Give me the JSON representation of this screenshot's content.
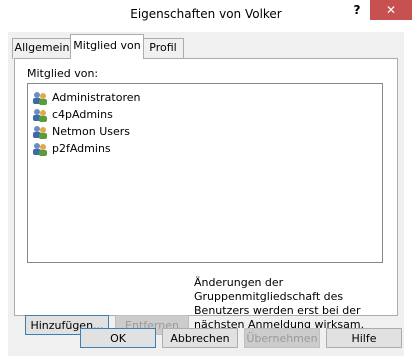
{
  "window": {
    "title": "Eigenschaften von Volker",
    "help": "?",
    "close": "✕"
  },
  "tabs": [
    {
      "label": "Allgemein",
      "active": false
    },
    {
      "label": "Mitglied von",
      "active": true
    },
    {
      "label": "Profil",
      "active": false
    }
  ],
  "member_of": {
    "label": "Mitglied von:",
    "items": [
      {
        "name": "Administratoren",
        "icon": "group-icon"
      },
      {
        "name": "c4pAdmins",
        "icon": "group-icon"
      },
      {
        "name": "Netmon Users",
        "icon": "group-icon"
      },
      {
        "name": "p2fAdmins",
        "icon": "group-icon"
      }
    ]
  },
  "buttons": {
    "add": "Hinzufügen...",
    "remove": "Entfernen",
    "ok": "OK",
    "cancel": "Abbrechen",
    "apply": "Übernehmen",
    "help": "Hilfe"
  },
  "note": "Änderungen der Gruppenmitgliedschaft des Benutzers werden erst bei der nächsten Anmeldung wirksam."
}
